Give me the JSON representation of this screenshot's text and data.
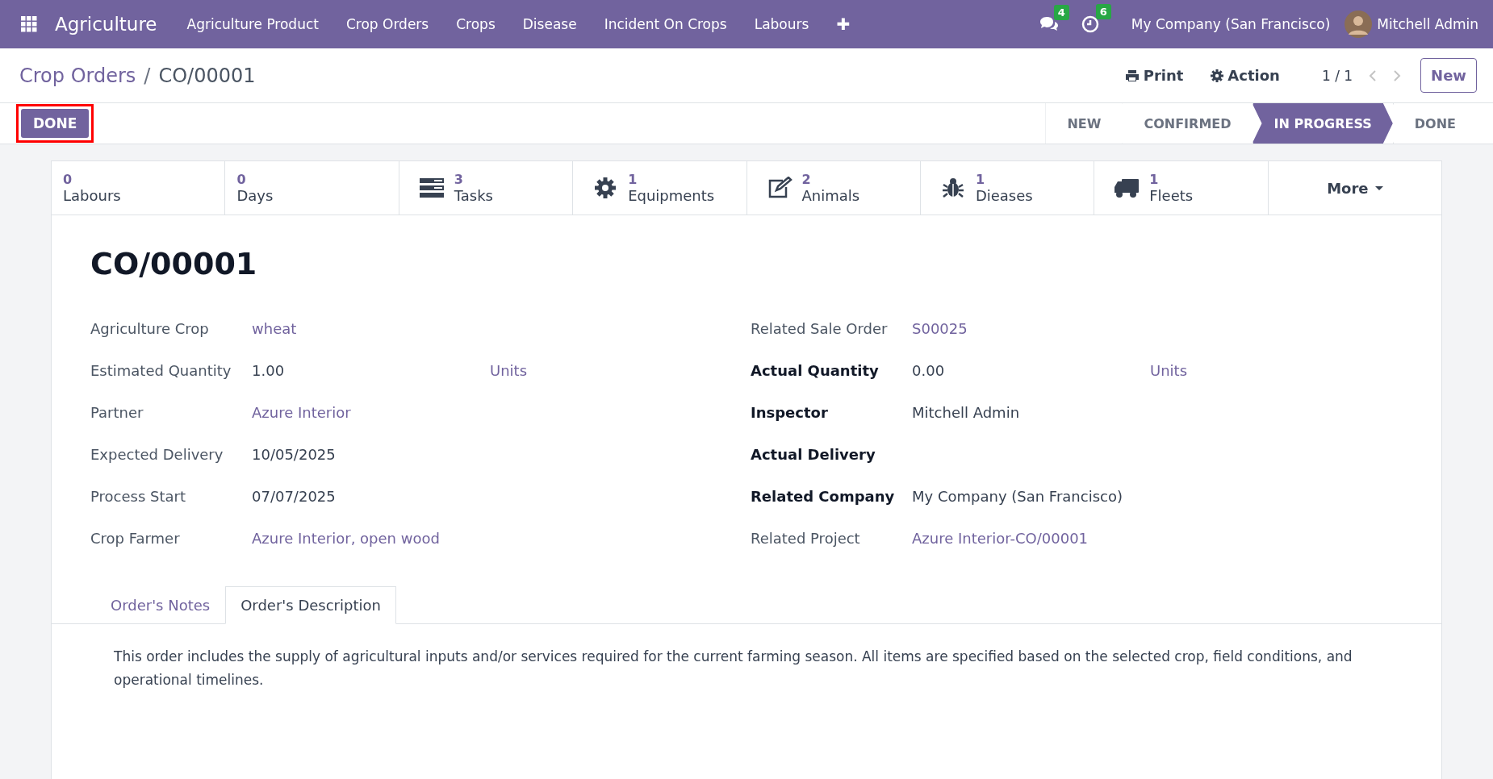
{
  "navbar": {
    "app_name": "Agriculture",
    "menu": [
      "Agriculture Product",
      "Crop Orders",
      "Crops",
      "Disease",
      "Incident On Crops",
      "Labours"
    ],
    "add_symbol": "✚",
    "messages_count": "4",
    "activities_count": "6",
    "company": "My Company (San Francisco)",
    "user": "Mitchell Admin"
  },
  "breadcrumb": {
    "parent": "Crop Orders",
    "separator": "/",
    "current": "CO/00001"
  },
  "header_actions": {
    "print": "Print",
    "action": "Action",
    "pager": "1 / 1",
    "new": "New"
  },
  "done_button": {
    "label": "DONE",
    "highlighted": true
  },
  "stages": [
    {
      "label": "NEW",
      "selected": false
    },
    {
      "label": "CONFIRMED",
      "selected": false
    },
    {
      "label": "IN PROGRESS",
      "selected": true
    },
    {
      "label": "DONE",
      "selected": false
    }
  ],
  "smart_buttons": [
    {
      "kind": "none",
      "count": "0",
      "label": "Labours"
    },
    {
      "kind": "none",
      "count": "0",
      "label": "Days"
    },
    {
      "kind": "tasks",
      "count": "3",
      "label": "Tasks"
    },
    {
      "kind": "gear",
      "count": "1",
      "label": "Equipments"
    },
    {
      "kind": "edit",
      "count": "2",
      "label": "Animals"
    },
    {
      "kind": "bug",
      "count": "1",
      "label": "Dieases"
    },
    {
      "kind": "truck",
      "count": "1",
      "label": "Fleets"
    }
  ],
  "more": "More",
  "record_title": "CO/00001",
  "left_fields": [
    {
      "label": "Agriculture Crop",
      "value": "wheat",
      "link": true,
      "bold": false
    },
    {
      "label": "Estimated Quantity",
      "value": "1.00",
      "link": false,
      "bold": false,
      "unit": "Units"
    },
    {
      "label": "Partner",
      "value": "Azure Interior",
      "link": true,
      "bold": false
    },
    {
      "label": "Expected Delivery",
      "value": "10/05/2025",
      "link": false,
      "bold": false
    },
    {
      "label": "Process Start",
      "value": "07/07/2025",
      "link": false,
      "bold": false
    },
    {
      "label": "Crop Farmer",
      "value": "Azure Interior, open wood",
      "link": true,
      "bold": false
    }
  ],
  "right_fields": [
    {
      "label": "Related Sale Order",
      "value": "S00025",
      "link": true,
      "bold": false
    },
    {
      "label": "Actual Quantity",
      "value": "0.00",
      "link": false,
      "bold": true,
      "unit": "Units"
    },
    {
      "label": "Inspector",
      "value": "Mitchell Admin",
      "link": false,
      "bold": true
    },
    {
      "label": "Actual Delivery",
      "bold": true
    },
    {
      "label": "Related Company",
      "value": "My Company (San Francisco)",
      "link": false,
      "bold": true
    },
    {
      "label": "Related Project",
      "value": "Azure Interior-CO/00001",
      "link": true,
      "bold": false
    }
  ],
  "tabs": [
    {
      "label": "Order's Notes",
      "selected": false
    },
    {
      "label": "Order's Description",
      "selected": true
    }
  ],
  "description": "This order includes the supply of agricultural inputs and/or services required for the current farming season. All items are specified based on the selected crop, field conditions, and operational timelines."
}
